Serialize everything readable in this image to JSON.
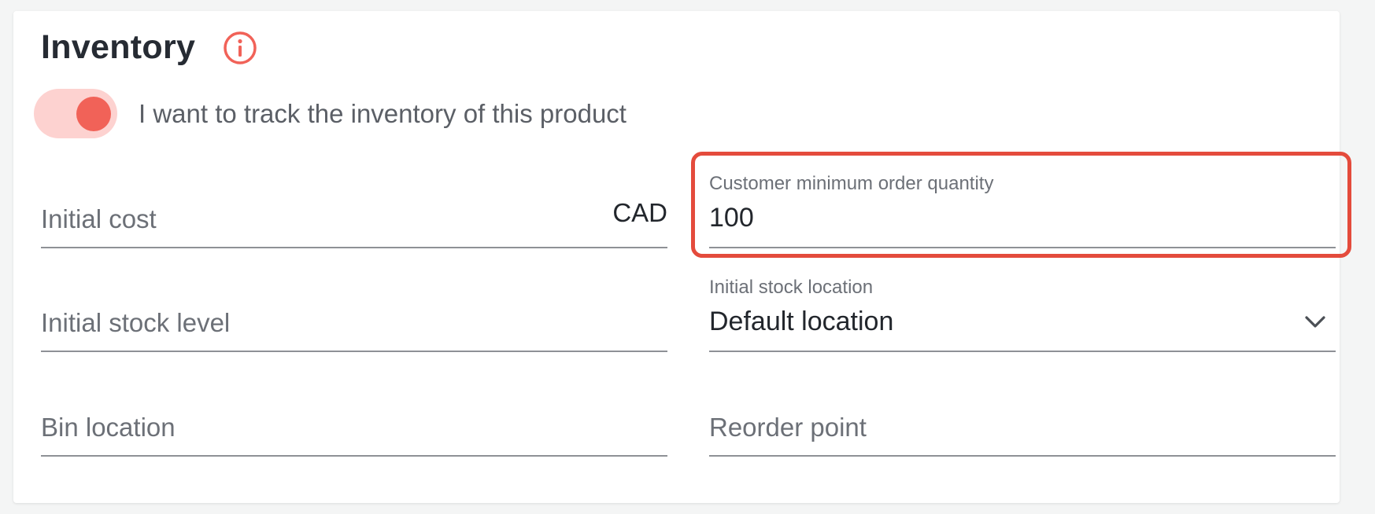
{
  "section": {
    "title": "Inventory",
    "info_icon": "info-icon"
  },
  "tracking_toggle": {
    "label": "I want to track the inventory of this product",
    "checked": true
  },
  "fields": {
    "initial_cost": {
      "placeholder": "Initial cost",
      "suffix": "CAD"
    },
    "customer_min_order_qty": {
      "label": "Customer minimum order quantity",
      "value": "100"
    },
    "initial_stock_level": {
      "placeholder": "Initial stock level"
    },
    "initial_stock_location": {
      "label": "Initial stock location",
      "value": "Default location",
      "icon": "chevron-down-icon"
    },
    "bin_location": {
      "placeholder": "Bin location"
    },
    "reorder_point": {
      "placeholder": "Reorder point"
    }
  },
  "colors": {
    "accent": "#f16258",
    "toggle_track": "#fdd2d0",
    "highlight_border": "#e44b3c"
  }
}
